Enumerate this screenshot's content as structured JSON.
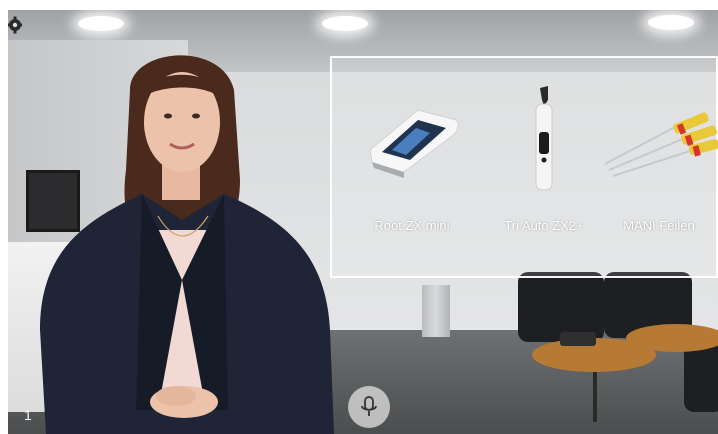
{
  "panel": {
    "products": [
      {
        "label": "Root ZX mini",
        "icon": "apex-locator-icon"
      },
      {
        "label": "Tri Auto ZX2+",
        "icon": "endo-motor-icon"
      },
      {
        "label": "MANI Feilen",
        "icon": "endo-files-icon"
      }
    ]
  },
  "controls": {
    "settings_icon": "gear-icon",
    "mic_icon": "microphone-icon"
  },
  "page_indicator": "1",
  "colors": {
    "panel_border": "#ffffff",
    "mic_bg": "#e1e1e1",
    "jacket": "#1f2536",
    "top": "#f2d9d4",
    "table": "#b77a35"
  }
}
